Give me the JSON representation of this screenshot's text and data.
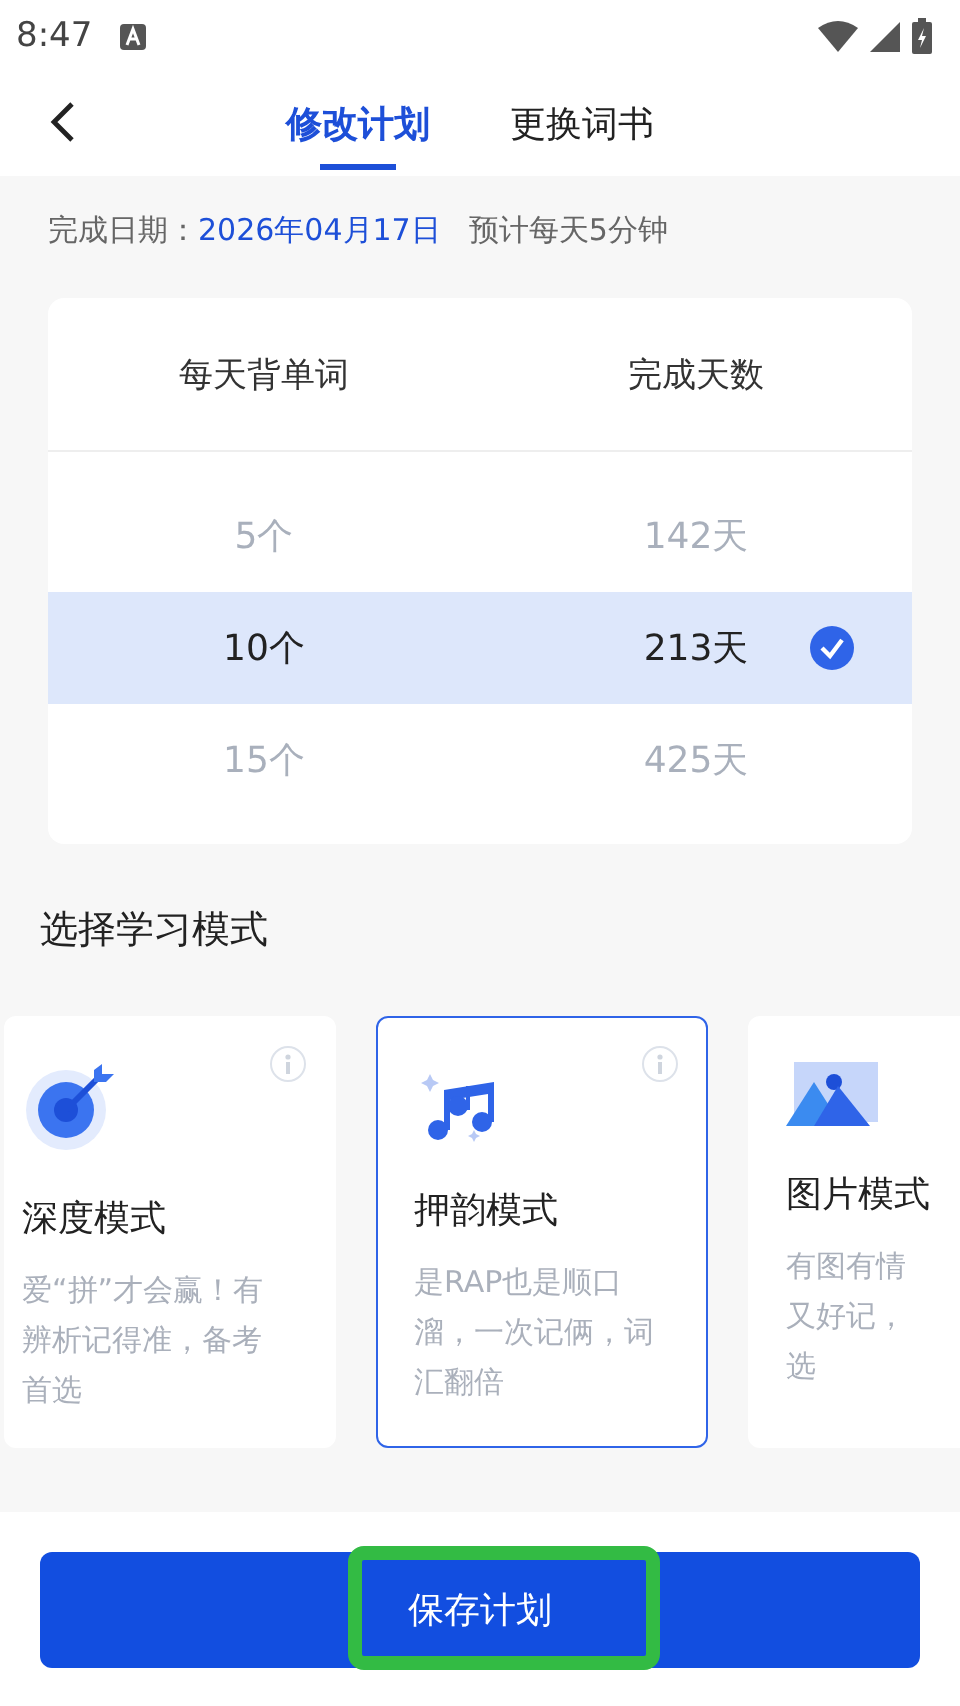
{
  "status_bar": {
    "time": "8:47"
  },
  "header": {
    "tabs": [
      {
        "label": "修改计划",
        "selected": true
      },
      {
        "label": "更换词书",
        "selected": false
      }
    ]
  },
  "plan_info": {
    "label": "完成日期：",
    "date": "2026年04月17日",
    "estimate": "预计每天5分钟"
  },
  "picker": {
    "columns": [
      "每天背单词",
      "完成天数"
    ],
    "rows": [
      {
        "count": "5个",
        "days": "142天",
        "selected": false
      },
      {
        "count": "10个",
        "days": "213天",
        "selected": true
      },
      {
        "count": "15个",
        "days": "425天",
        "selected": false
      }
    ]
  },
  "mode_section": {
    "title": "选择学习模式",
    "modes": [
      {
        "title": "深度模式",
        "description": [
          "爱“拼”才会赢！有",
          "辨析记得准，备考",
          "首选"
        ],
        "selected": false,
        "info": true
      },
      {
        "title": "押韵模式",
        "description": [
          "是RAP也是顺口",
          "溜，一次记俩，词",
          "汇翻倍"
        ],
        "selected": true,
        "info": true
      },
      {
        "title": "图片模式",
        "description": [
          "有图有情",
          "又好记，",
          "选"
        ],
        "selected": false
      }
    ]
  },
  "save_button": {
    "label": "保存计划",
    "highlighted": true
  }
}
